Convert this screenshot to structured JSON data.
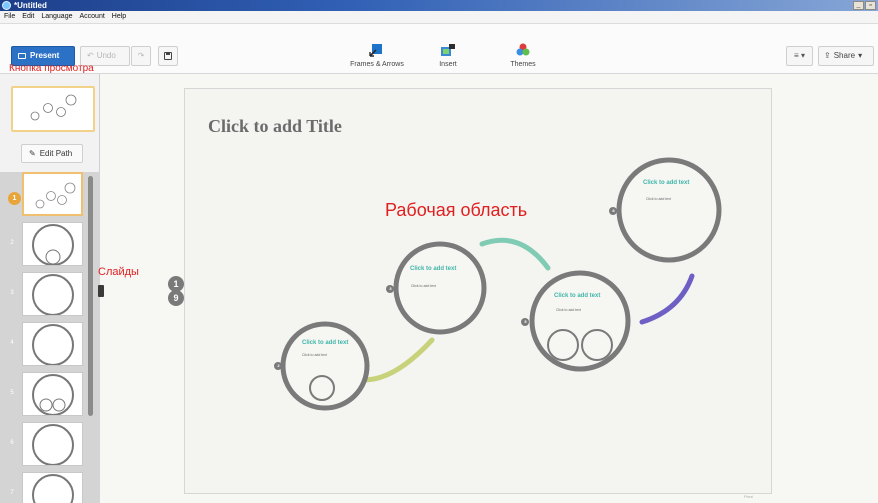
{
  "window": {
    "title": "*Untitled",
    "min": "_",
    "restore": "&#9633;"
  },
  "menu": [
    "File",
    "Edit",
    "Language",
    "Account",
    "Help"
  ],
  "toolbar": {
    "present_label": "Present",
    "undo_label": "Undo",
    "tools": [
      {
        "name": "frames-arrows",
        "label": "Frames & Arrows",
        "icon": "frames-arrows-icon"
      },
      {
        "name": "insert",
        "label": "Insert",
        "icon": "insert-icon"
      },
      {
        "name": "themes",
        "label": "Themes",
        "icon": "themes-icon"
      }
    ],
    "share_label": "Share"
  },
  "annotations": {
    "preview_button": "Кнопка просмотра",
    "slides": "Слайды",
    "workspace": "Рабочая область"
  },
  "leftpanel": {
    "edit_path_label": "Edit Path",
    "slide_numbers": [
      "1",
      "2",
      "3",
      "4",
      "5",
      "6",
      "7"
    ]
  },
  "canvas": {
    "title": "Click to add Title",
    "nav_badges": [
      "1",
      "9"
    ],
    "frames": [
      {
        "number": "2",
        "heading": "Click to add text",
        "body": "Click to add text"
      },
      {
        "number": "3",
        "heading": "Click to add text",
        "body": "Click to add text"
      },
      {
        "number": "5",
        "heading": "Click to add text",
        "body": "Click to add text"
      },
      {
        "number": "8",
        "heading": "Click to add text",
        "body": "Click to add text"
      }
    ],
    "watermark": "Prezi"
  },
  "colors": {
    "present_blue": "#2b71c6",
    "annotation_red": "#e02020",
    "frame_heading": "#3fb5a8",
    "active_slide": "#f0c070"
  }
}
